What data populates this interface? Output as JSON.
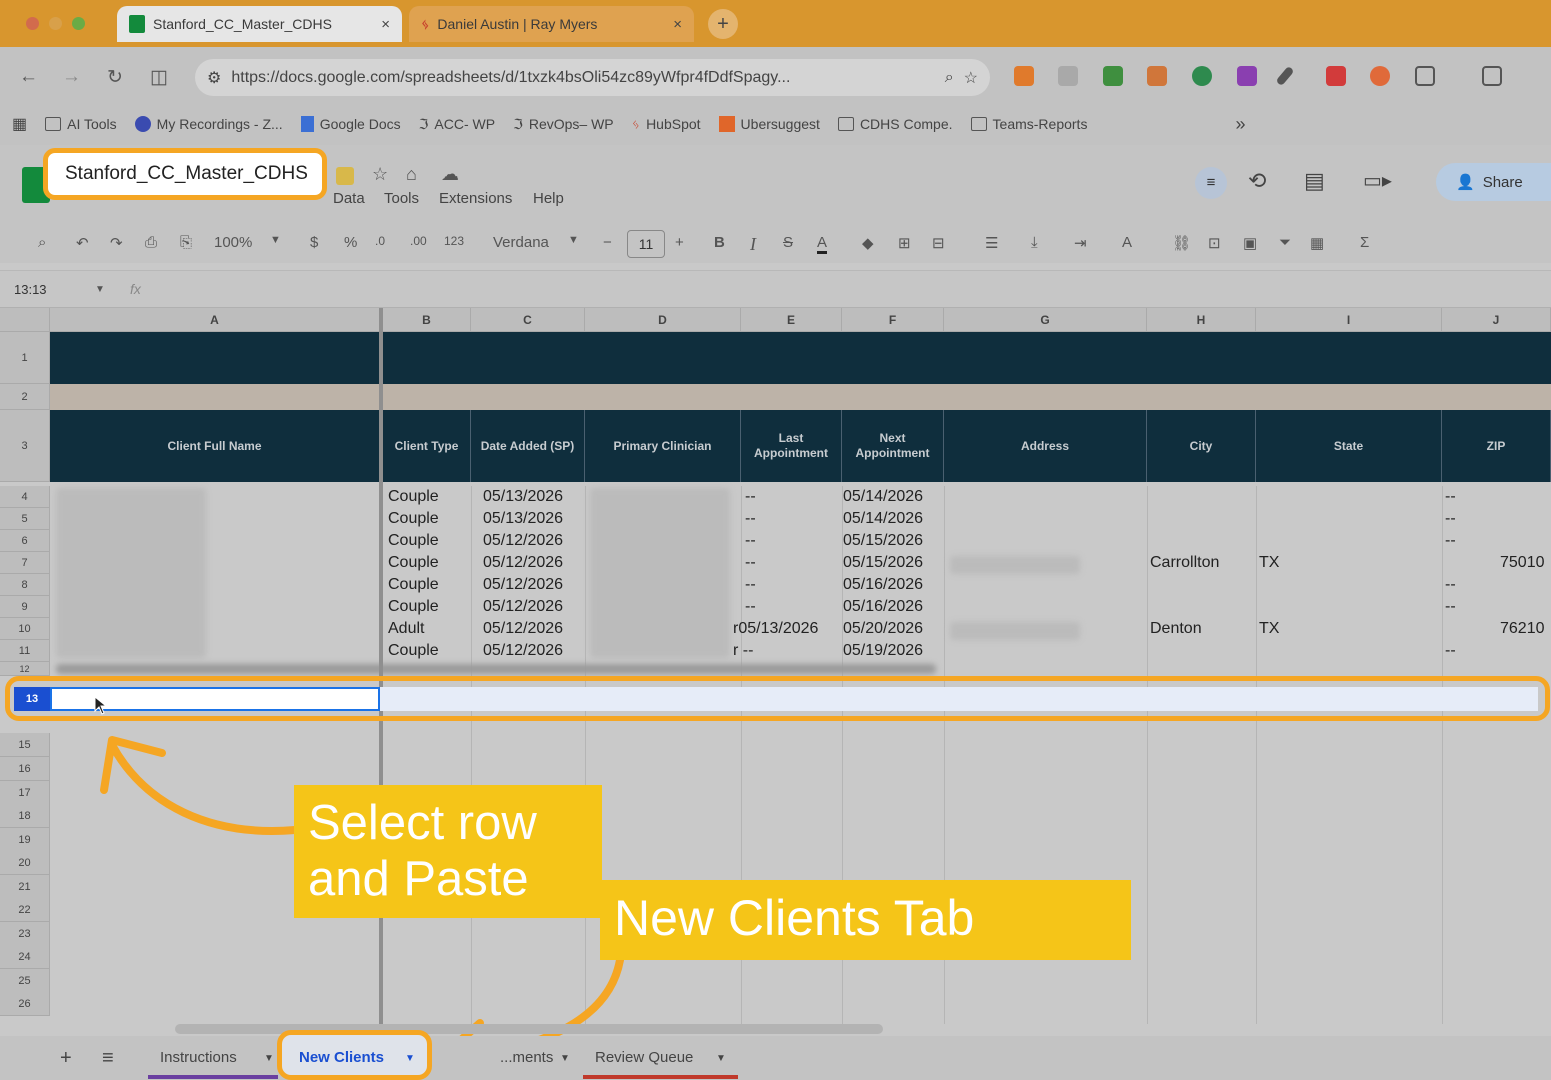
{
  "browser": {
    "tabs": [
      {
        "title": "Stanford_CC_Master_CDHS",
        "close": "×"
      },
      {
        "title": "Daniel Austin | Ray Myers",
        "close": "×"
      }
    ],
    "new_tab": "+",
    "url": "https://docs.google.com/spreadsheets/d/1txzk4bsOli54zc89yWfpr4fDdfSpagy...",
    "bookmarks": [
      "AI Tools",
      "My Recordings - Z...",
      "Google Docs",
      "ACC- WP",
      "RevOps– WP",
      "HubSpot",
      "Ubersuggest",
      "CDHS Compe.",
      "Teams-Reports"
    ],
    "bookmarks_more": "»"
  },
  "sheets": {
    "doc_title": "Stanford_CC_Master_CDHS",
    "menus": [
      "Data",
      "Tools",
      "Extensions",
      "Help"
    ],
    "share_label": "Share",
    "toolbar": {
      "zoom": "100%",
      "currency": "$",
      "percent": "%",
      "dec_dec": ".0",
      "dec_inc": ".00",
      "format_num": "123",
      "font": "Verdana",
      "font_size": "11",
      "minus": "−",
      "plus": "+",
      "bold": "B",
      "italic": "I",
      "strike": "S",
      "textcolor": "A",
      "sum": "Σ"
    },
    "name_box": "13:13",
    "fx": "fx"
  },
  "grid": {
    "columns": [
      "A",
      "B",
      "C",
      "D",
      "E",
      "F",
      "G",
      "H",
      "I",
      "J"
    ],
    "header_row": [
      "Client Full Name",
      "Client Type",
      "Date Added (SP)",
      "Primary Clinician",
      "Last Appointment",
      "Next Appointment",
      "Address",
      "City",
      "State",
      "ZIP"
    ],
    "row_numbers": [
      "1",
      "2",
      "3",
      "4",
      "5",
      "6",
      "7",
      "8",
      "9",
      "10",
      "11",
      "12",
      "13",
      "15",
      "16",
      "17",
      "18",
      "19",
      "20",
      "21",
      "22",
      "23",
      "24",
      "25",
      "26"
    ],
    "rows": [
      {
        "type": "Couple",
        "date": "05/13/2026",
        "last": "--",
        "next": "05/14/2026",
        "city": "",
        "state": "",
        "zip": "--"
      },
      {
        "type": "Couple",
        "date": "05/13/2026",
        "last": "--",
        "next": "05/14/2026",
        "city": "",
        "state": "",
        "zip": "--"
      },
      {
        "type": "Couple",
        "date": "05/12/2026",
        "last": "--",
        "next": "05/15/2026",
        "city": "",
        "state": "",
        "zip": "--"
      },
      {
        "type": "Couple",
        "date": "05/12/2026",
        "last": "--",
        "next": "05/15/2026",
        "city": "Carrollton",
        "state": "TX",
        "zip": "75010"
      },
      {
        "type": "Couple",
        "date": "05/12/2026",
        "last": "--",
        "next": "05/16/2026",
        "city": "",
        "state": "",
        "zip": "--"
      },
      {
        "type": "Couple",
        "date": "05/12/2026",
        "last": "--",
        "next": "05/16/2026",
        "city": "",
        "state": "",
        "zip": "--"
      },
      {
        "type": "Adult",
        "date": "05/12/2026",
        "last": "r05/13/2026",
        "next": "05/20/2026",
        "city": "Denton",
        "state": "TX",
        "zip": "76210"
      },
      {
        "type": "Couple",
        "date": "05/12/2026",
        "last": "r --",
        "next": "05/19/2026",
        "city": "",
        "state": "",
        "zip": "--"
      }
    ],
    "selected_row_label": "13"
  },
  "sheet_tabs": {
    "add": "+",
    "list": "≡",
    "tabs": [
      "Instructions",
      "New Clients",
      "...ments",
      "Review Queue"
    ]
  },
  "annotations": {
    "callout_1_line1": "Select row",
    "callout_1_line2": "and Paste",
    "callout_2": "New Clients Tab"
  },
  "colors": {
    "accent": "#f5a623",
    "callout": "#f5c518",
    "header": "#0f2e3d",
    "selection": "#1a4fd1"
  }
}
